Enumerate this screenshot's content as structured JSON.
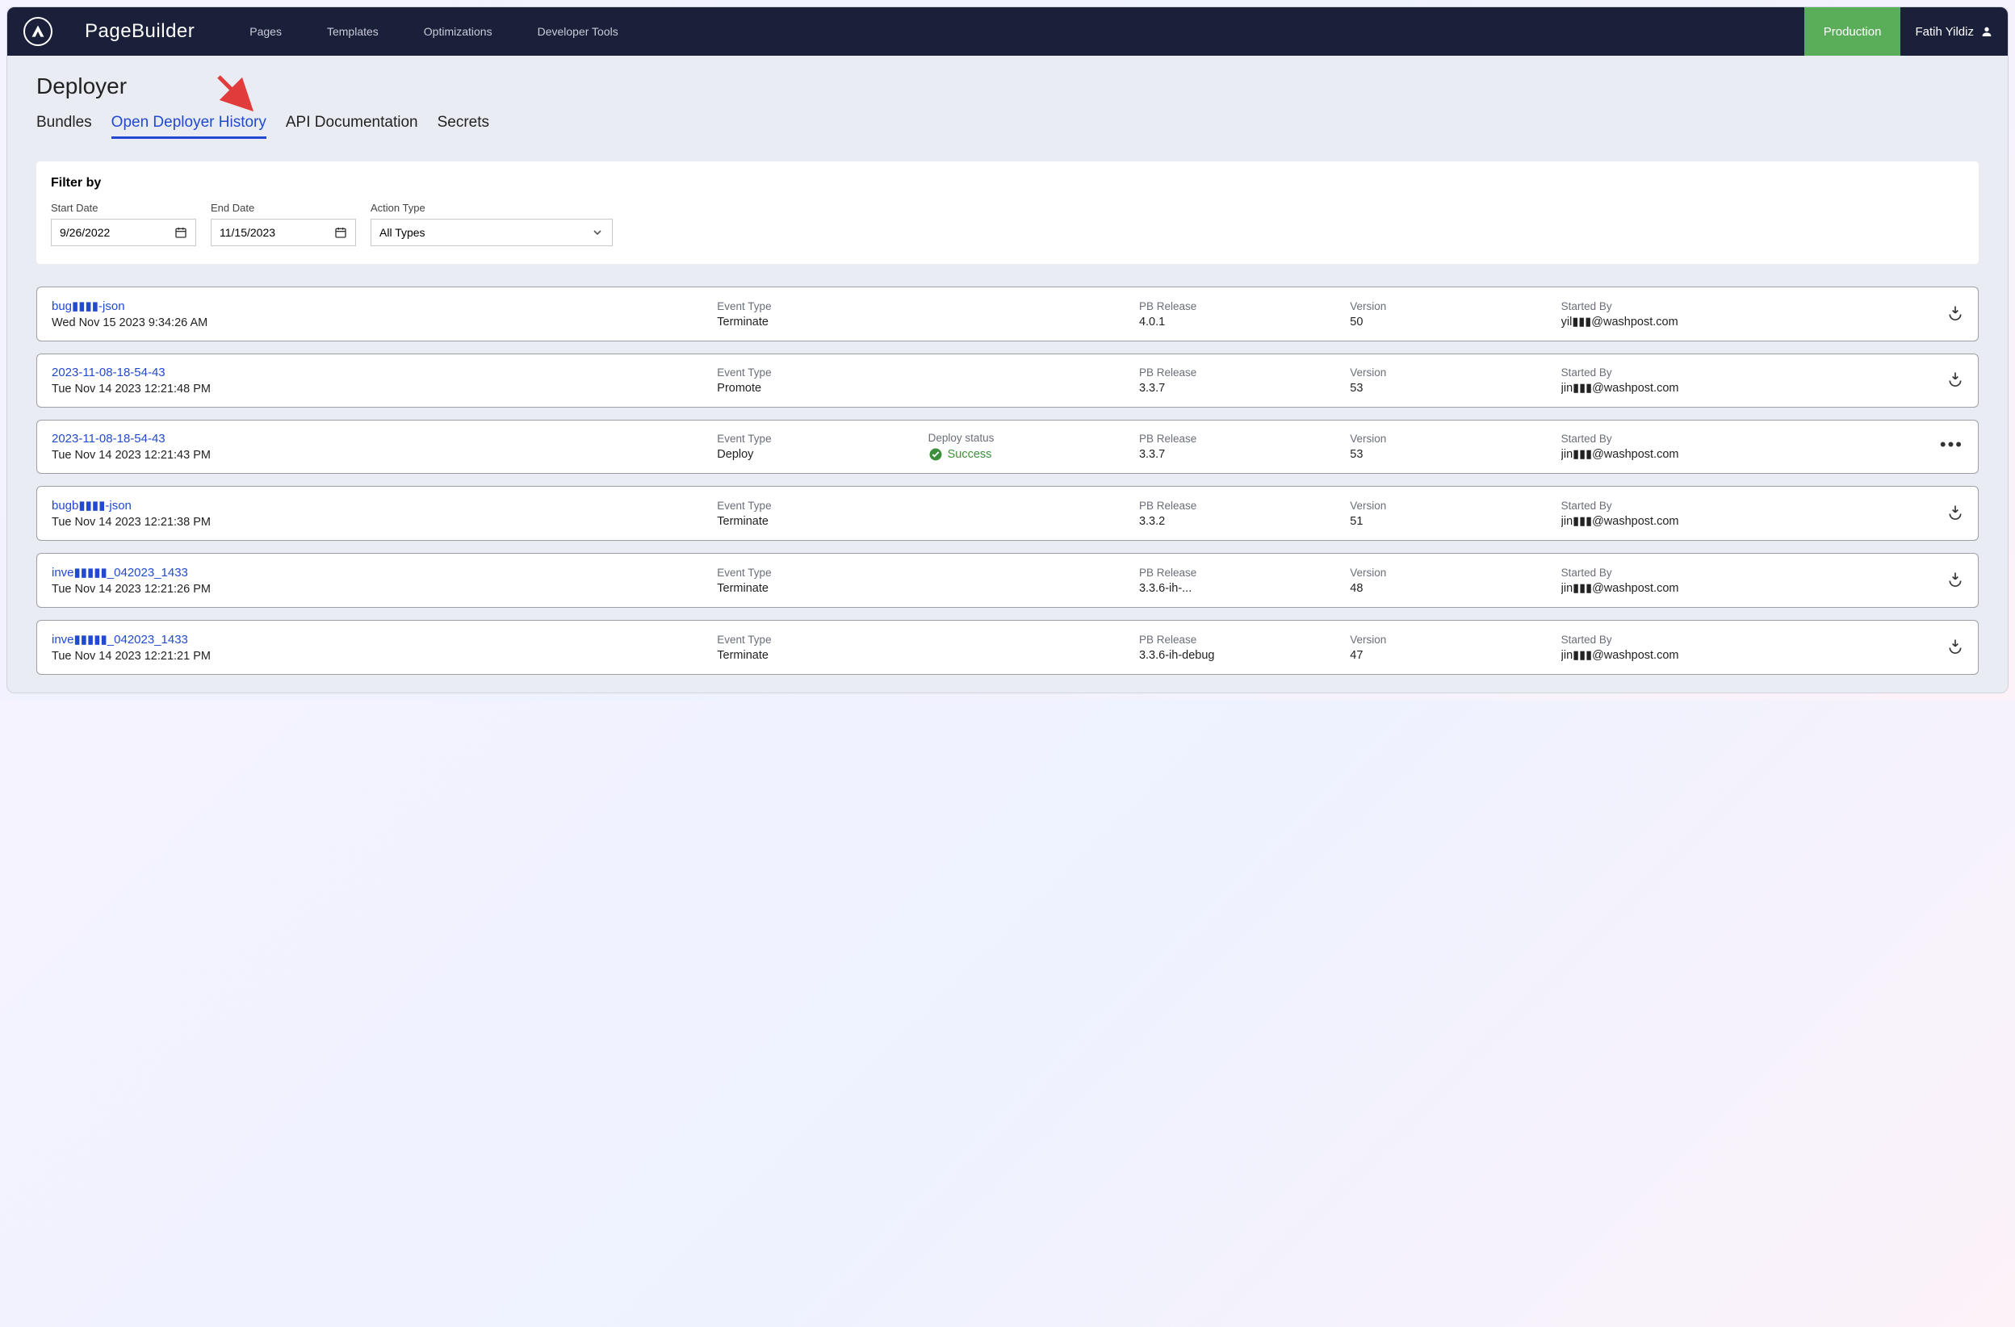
{
  "brand": "PageBuilder",
  "nav": [
    "Pages",
    "Templates",
    "Optimizations",
    "Developer Tools"
  ],
  "env": "Production",
  "user": "Fatih Yildiz",
  "page_title": "Deployer",
  "tabs": [
    "Bundles",
    "Open Deployer History",
    "API Documentation",
    "Secrets"
  ],
  "active_tab": 1,
  "filter": {
    "title": "Filter by",
    "start_label": "Start Date",
    "start_value": "9/26/2022",
    "end_label": "End Date",
    "end_value": "11/15/2023",
    "action_label": "Action Type",
    "action_value": "All Types"
  },
  "col_labels": {
    "event_type": "Event Type",
    "deploy_status": "Deploy status",
    "pb_release": "PB Release",
    "version": "Version",
    "started_by": "Started By"
  },
  "rows": [
    {
      "title": "bug▮▮▮▮-json",
      "time": "Wed Nov 15 2023 9:34:26 AM",
      "event_type": "Terminate",
      "deploy_status": null,
      "pb_release": "4.0.1",
      "version": "50",
      "started_by": "yil▮▮▮@washpost.com",
      "action": "download"
    },
    {
      "title": "2023-11-08-18-54-43",
      "time": "Tue Nov 14 2023 12:21:48 PM",
      "event_type": "Promote",
      "deploy_status": null,
      "pb_release": "3.3.7",
      "version": "53",
      "started_by": "jin▮▮▮@washpost.com",
      "action": "download"
    },
    {
      "title": "2023-11-08-18-54-43",
      "time": "Tue Nov 14 2023 12:21:43 PM",
      "event_type": "Deploy",
      "deploy_status": "Success",
      "pb_release": "3.3.7",
      "version": "53",
      "started_by": "jin▮▮▮@washpost.com",
      "action": "dots"
    },
    {
      "title": "bugb▮▮▮▮-json",
      "time": "Tue Nov 14 2023 12:21:38 PM",
      "event_type": "Terminate",
      "deploy_status": null,
      "pb_release": "3.3.2",
      "version": "51",
      "started_by": "jin▮▮▮@washpost.com",
      "action": "download"
    },
    {
      "title": "inve▮▮▮▮▮_042023_1433",
      "time": "Tue Nov 14 2023 12:21:26 PM",
      "event_type": "Terminate",
      "deploy_status": null,
      "pb_release": "3.3.6-ih-...",
      "version": "48",
      "started_by": "jin▮▮▮@washpost.com",
      "action": "download"
    },
    {
      "title": "inve▮▮▮▮▮_042023_1433",
      "time": "Tue Nov 14 2023 12:21:21 PM",
      "event_type": "Terminate",
      "deploy_status": null,
      "pb_release": "3.3.6-ih-debug",
      "version": "47",
      "started_by": "jin▮▮▮@washpost.com",
      "action": "download"
    }
  ]
}
